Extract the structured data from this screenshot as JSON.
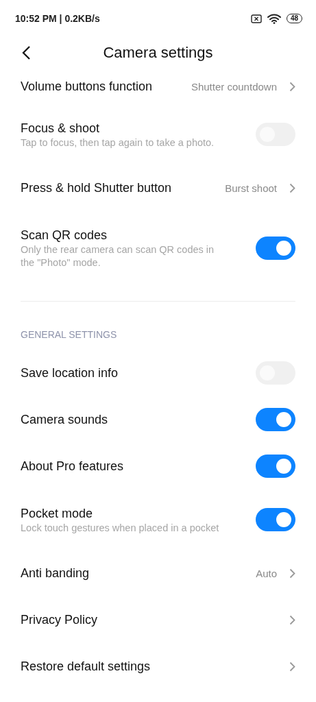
{
  "status_bar": {
    "time": "10:52 PM | 0.2KB/s",
    "battery": "48"
  },
  "header": {
    "title": "Camera settings"
  },
  "sections": [
    {
      "rows": [
        {
          "kind": "link",
          "title": "Volume buttons function",
          "value": "Shutter countdown"
        },
        {
          "kind": "toggle",
          "title": "Focus & shoot",
          "description": "Tap to focus, then tap again to take a photo.",
          "on": false
        },
        {
          "kind": "link",
          "title": "Press & hold Shutter button",
          "value": "Burst shoot"
        },
        {
          "kind": "toggle",
          "title": "Scan QR codes",
          "description": "Only the rear camera can scan QR codes in the \"Photo\" mode.",
          "on": true
        }
      ]
    },
    {
      "heading": "GENERAL SETTINGS",
      "rows": [
        {
          "kind": "toggle",
          "title": "Save location info",
          "on": false
        },
        {
          "kind": "toggle",
          "title": "Camera sounds",
          "on": true
        },
        {
          "kind": "toggle",
          "title": "About Pro features",
          "on": true
        },
        {
          "kind": "toggle",
          "title": "Pocket mode",
          "description": "Lock touch gestures when placed in a pocket",
          "on": true
        },
        {
          "kind": "link",
          "title": "Anti banding",
          "value": "Auto"
        },
        {
          "kind": "link",
          "title": "Privacy Policy"
        },
        {
          "kind": "link",
          "title": "Restore default settings"
        }
      ]
    }
  ]
}
